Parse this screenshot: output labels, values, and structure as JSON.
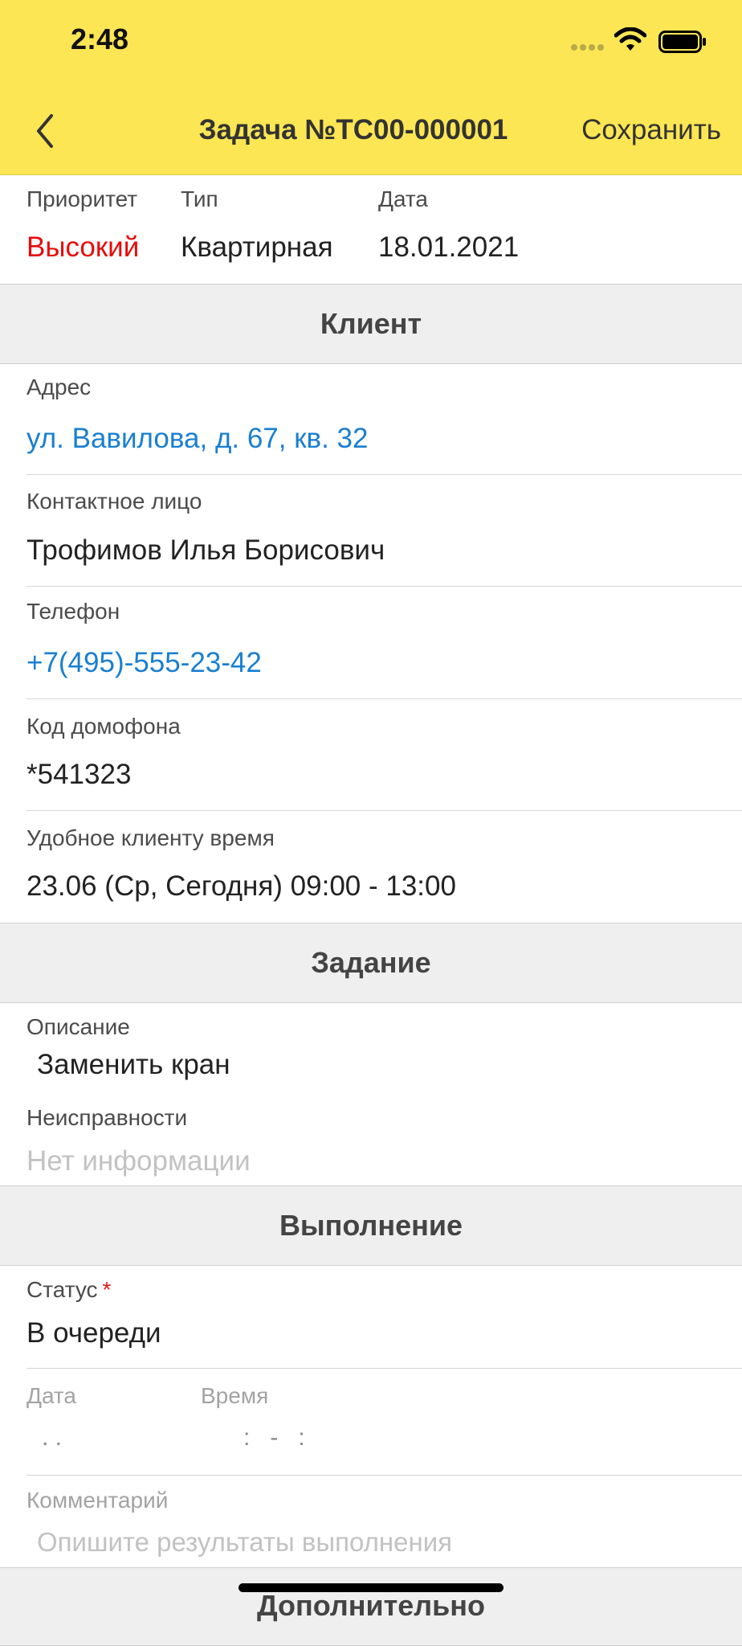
{
  "status_bar": {
    "time": "2:48"
  },
  "nav": {
    "title": "Задача №ТС00-000001",
    "save_label": "Сохранить"
  },
  "summary": {
    "priority_label": "Приоритет",
    "priority_value": "Высокий",
    "type_label": "Тип",
    "type_value": "Квартирная",
    "date_label": "Дата",
    "date_value": "18.01.2021"
  },
  "client": {
    "header": "Клиент",
    "address_label": "Адрес",
    "address_value": "ул. Вавилова, д. 67, кв. 32",
    "contact_label": "Контактное лицо",
    "contact_value": "Трофимов Илья Борисович",
    "phone_label": "Телефон",
    "phone_value": "+7(495)-555-23-42",
    "intercom_label": "Код домофона",
    "intercom_value": "*541323",
    "time_label": "Удобное клиенту время",
    "time_value": "23.06 (Ср, Сегодня)  09:00 - 13:00"
  },
  "task": {
    "header": "Задание",
    "description_label": "Описание",
    "description_value": "Заменить кран",
    "faults_label": "Неисправности",
    "faults_value": "Нет информации"
  },
  "execution": {
    "header": "Выполнение",
    "status_label": "Статус",
    "status_required": "*",
    "status_value": "В очереди",
    "date_label": "Дата",
    "date_value": ".   .",
    "time_label": "Время",
    "time_value": ":   -   :",
    "comment_label": "Комментарий",
    "comment_placeholder": "Опишите результаты выполнения"
  },
  "additional": {
    "header": "Дополнительно"
  },
  "colors": {
    "header_bg": "#fce653",
    "accent_link": "#1a7fd1",
    "priority_high": "#e80b0b",
    "section_bg": "#efefef"
  }
}
